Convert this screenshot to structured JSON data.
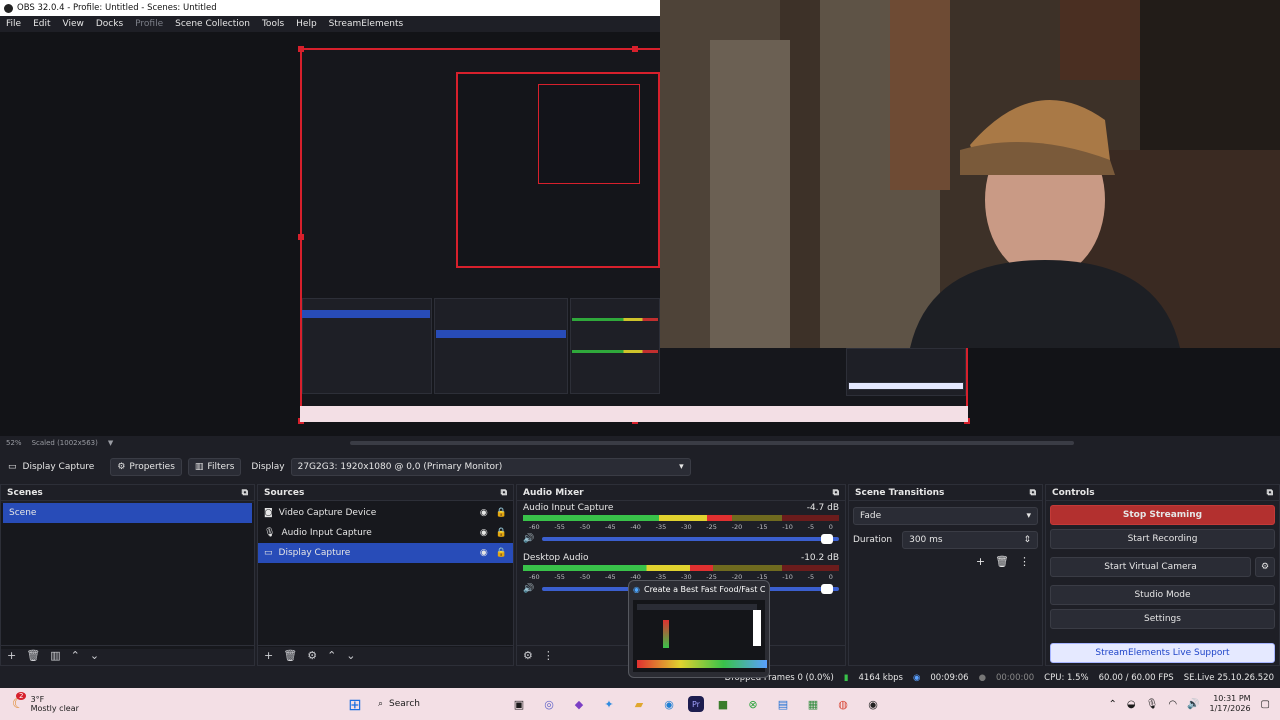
{
  "title": "OBS 32.0.4 - Profile: Untitled - Scenes: Untitled",
  "menu": [
    "File",
    "Edit",
    "View",
    "Docks",
    "Profile",
    "Scene Collection",
    "Tools",
    "Help",
    "StreamElements"
  ],
  "preview_status": {
    "zoom": "52%",
    "scale": "Scaled (1002x563)"
  },
  "source_bar": {
    "source": "Display Capture",
    "properties": "Properties",
    "filters": "Filters",
    "display_label": "Display",
    "display_value": "27G2G3: 1920x1080 @ 0,0 (Primary Monitor)"
  },
  "scenes": {
    "title": "Scenes",
    "items": [
      "Scene"
    ]
  },
  "sources": {
    "title": "Sources",
    "items": [
      "Video Capture Device",
      "Audio Input Capture",
      "Display Capture"
    ]
  },
  "mixer": {
    "title": "Audio Mixer",
    "channels": [
      {
        "name": "Audio Input Capture",
        "db": "-4.7 dB",
        "level": 0.66,
        "volume": 0.98
      },
      {
        "name": "Desktop Audio",
        "db": "-10.2 dB",
        "level": 0.6,
        "volume": 0.98
      }
    ],
    "ticks": [
      "-60",
      "-55",
      "-50",
      "-45",
      "-40",
      "-35",
      "-30",
      "-25",
      "-20",
      "-15",
      "-10",
      "-5",
      "0"
    ]
  },
  "transitions": {
    "title": "Scene Transitions",
    "type": "Fade",
    "duration_label": "Duration",
    "duration": "300 ms"
  },
  "controls": {
    "title": "Controls",
    "stop_streaming": "Stop Streaming",
    "start_recording": "Start Recording",
    "virtual_camera": "Start Virtual Camera",
    "studio_mode": "Studio Mode",
    "settings": "Settings",
    "se_support": "StreamElements Live Support"
  },
  "status": {
    "dropped": "Dropped Frames 0 (0.0%)",
    "bitrate": "4164 kbps",
    "stream_time": "00:09:06",
    "rec_time": "00:00:00",
    "cpu": "CPU: 1.5%",
    "fps": "60.00 / 60.00 FPS",
    "se": "SE.Live 25.10.26.520"
  },
  "popup": {
    "title": "Create a Best Fast Food/Fast Ca..."
  },
  "taskbar": {
    "weather_temp": "3°F",
    "weather_desc": "Mostly clear",
    "search": "Search",
    "time": "10:31 PM",
    "date": "1/17/2026",
    "badge": "2"
  },
  "colors": {
    "accent": "#284cb8",
    "stop": "#b3302f",
    "taskbar": "#f3dfe5"
  }
}
